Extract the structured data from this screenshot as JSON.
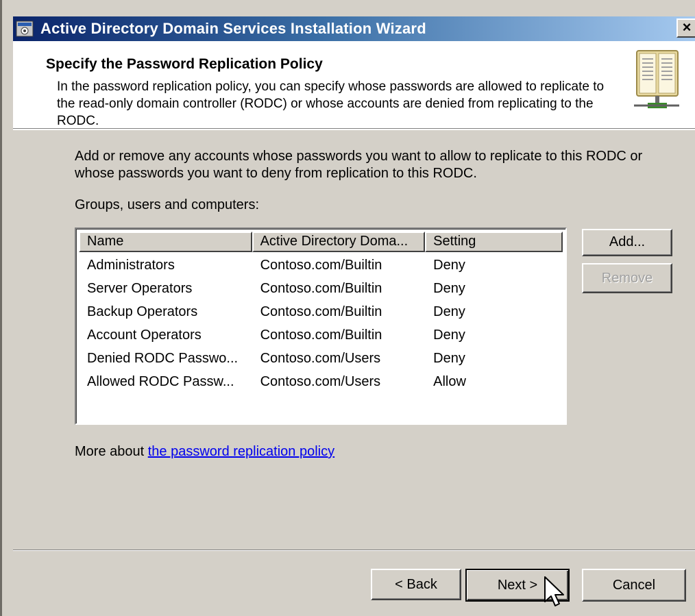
{
  "window": {
    "title": "Active Directory Domain Services Installation Wizard",
    "close_label": "×"
  },
  "header": {
    "title": "Specify the Password Replication Policy",
    "description": "In the password replication policy, you can specify whose passwords are allowed to replicate to the read-only domain controller (RODC) or whose accounts are denied from replicating to the RODC.",
    "icon": "book-icon"
  },
  "main": {
    "instructions": "Add or remove any accounts whose passwords you want to allow to replicate to this RODC or whose passwords you want to deny from replication to this RODC.",
    "groups_label": "Groups, users and computers:",
    "columns": [
      "Name",
      "Active Directory Doma...",
      "Setting"
    ],
    "rows": [
      {
        "name": "Administrators",
        "domain": "Contoso.com/Builtin",
        "setting": "Deny"
      },
      {
        "name": "Server Operators",
        "domain": "Contoso.com/Builtin",
        "setting": "Deny"
      },
      {
        "name": "Backup Operators",
        "domain": "Contoso.com/Builtin",
        "setting": "Deny"
      },
      {
        "name": "Account Operators",
        "domain": "Contoso.com/Builtin",
        "setting": "Deny"
      },
      {
        "name": "Denied RODC Passwo...",
        "domain": "Contoso.com/Users",
        "setting": "Deny"
      },
      {
        "name": "Allowed RODC Passw...",
        "domain": "Contoso.com/Users",
        "setting": "Allow"
      }
    ],
    "add_label": "Add...",
    "remove_label": "Remove",
    "more_about_prefix": "More about ",
    "more_about_link": "the password replication policy"
  },
  "footer": {
    "back_label": "< Back",
    "next_label": "Next >",
    "cancel_label": "Cancel"
  },
  "colors": {
    "title_gradient_start": "#0a246a",
    "title_gradient_end": "#a6caf0",
    "dialog_bg": "#d4d0c8",
    "link": "#0000ee"
  }
}
